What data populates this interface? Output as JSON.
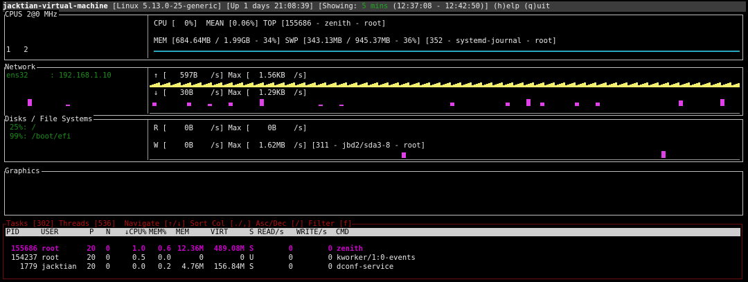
{
  "header": {
    "hostname": "jacktian-virtual-machine",
    "kernel": "[Linux 5.13.0-25-generic]",
    "uptime": "[Up 1 days 21:08:39]",
    "showing_label": "[Showing: ",
    "showing_value": "5 mins",
    "showing_range": " (12:37:08 - 12:42:50)]",
    "help_quit": "(h)elp (q)uit"
  },
  "cpu": {
    "title": "CPUS 2@0 MHz",
    "cores": "1   2",
    "line1": "CPU [  0%]  MEAN [0.06%] TOP [155686 - zenith - root]",
    "line2": "MEM [684.64MB / 1.99GB - 34%] SWP [343.13MB / 945.37MB - 36%] [352 - systemd-journal - root]",
    "mem_percent": 34,
    "bar_color": "#2aa7c0"
  },
  "network": {
    "title": "Network",
    "iface": "ens32     : 192.168.1.10",
    "up_line": "↑ [   597B   /s] Max [  1.56KB  /s]",
    "down_line": "↓ [   30B    /s] Max [  1.29KB  /s]",
    "up_color": "#f2ef6e",
    "down_color": "#e040e8"
  },
  "disks": {
    "title": "Disks / File Systems",
    "fs": [
      "25%: /",
      "99%: /boot/efi"
    ],
    "read_line": "R [    0B    /s] Max [    0B    /s]",
    "write_line": "W [    0B    /s] Max [  1.62MB  /s] [311 - jbd2/sda3-8 - root]",
    "bar_color": "#e040e8"
  },
  "graphics": {
    "title": "Graphics"
  },
  "tasks": {
    "status_line": "Tasks [302] Threads [536]  Navigate [↑/↓] Sort Col [./,] Asc/Dec [/] Filter [f]",
    "columns": [
      "PID",
      "USER",
      "P",
      "N",
      "↓CPU%",
      "MEM%",
      "MEM",
      "VIRT",
      "S",
      "READ/s",
      "WRITE/s",
      "CMD"
    ],
    "rows": [
      [
        "155686",
        "root",
        "20",
        "0",
        "1.0",
        "0.6",
        "12.36M",
        "489.08M",
        "S",
        "0",
        "0",
        "zenith"
      ],
      [
        "154237",
        "root",
        "20",
        "0",
        "0.5",
        "0.0",
        "0",
        "0",
        "U",
        "0",
        "0",
        "kworker/1:0-events"
      ],
      [
        "1779",
        "jacktian",
        "20",
        "0",
        "0.0",
        "0.2",
        "4.76M",
        "156.84M",
        "S",
        "0",
        "0",
        "dconf-service"
      ]
    ],
    "highlight_color": "#c800c8"
  }
}
